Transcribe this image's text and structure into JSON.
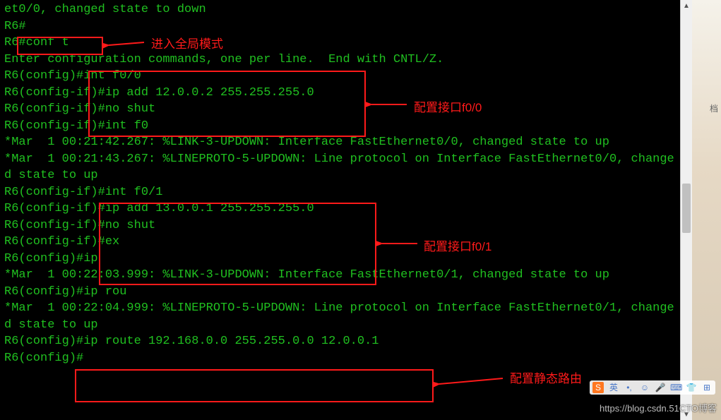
{
  "terminal": {
    "lines": [
      "et0/0, changed state to down",
      "R6#",
      "R6#conf t",
      "Enter configuration commands, one per line.  End with CNTL/Z.",
      "R6(config)#int f0/0",
      "R6(config-if)#ip add 12.0.0.2 255.255.255.0",
      "R6(config-if)#no shut",
      "R6(config-if)#int f0",
      "*Mar  1 00:21:42.267: %LINK-3-UPDOWN: Interface FastEthernet0/0, changed state to up",
      "*Mar  1 00:21:43.267: %LINEPROTO-5-UPDOWN: Line protocol on Interface FastEthernet0/0, changed state to up",
      "R6(config-if)#int f0/1",
      "R6(config-if)#ip add 13.0.0.1 255.255.255.0",
      "R6(config-if)#no shut",
      "R6(config-if)#ex",
      "R6(config)#ip",
      "*Mar  1 00:22:03.999: %LINK-3-UPDOWN: Interface FastEthernet0/1, changed state to up",
      "R6(config)#ip rou",
      "*Mar  1 00:22:04.999: %LINEPROTO-5-UPDOWN: Line protocol on Interface FastEthernet0/1, changed state to up",
      "R6(config)#ip route 192.168.0.0 255.255.0.0 12.0.0.1",
      "R6(config)#"
    ]
  },
  "annotations": {
    "box1": {
      "label": "进入全局模式"
    },
    "box2": {
      "label": "配置接口f0/0"
    },
    "box3": {
      "label": "配置接口f0/1"
    },
    "box4": {
      "label": "配置静态路由"
    }
  },
  "rightpanel": {
    "label": "档"
  },
  "watermark": "https://blog.csdn.51CTO博客"
}
